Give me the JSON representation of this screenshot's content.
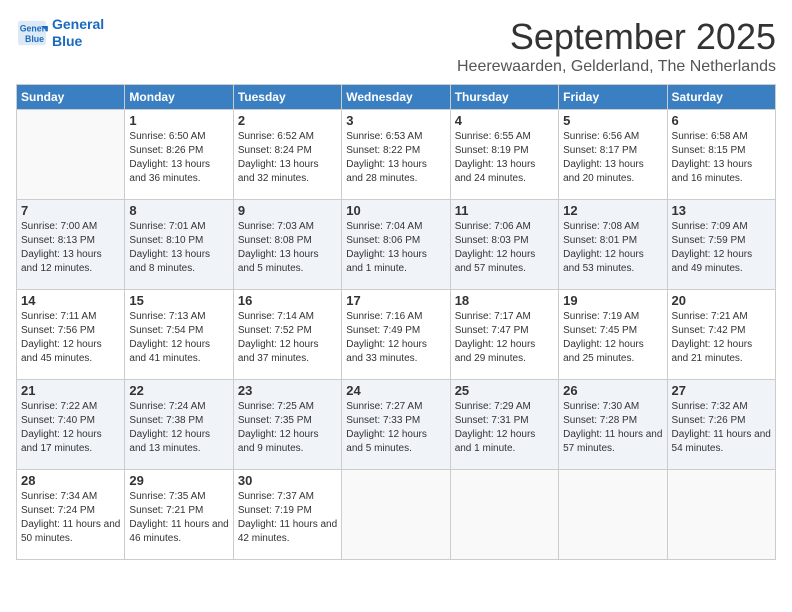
{
  "header": {
    "logo_line1": "General",
    "logo_line2": "Blue",
    "month": "September 2025",
    "location": "Heerewaarden, Gelderland, The Netherlands"
  },
  "days_of_week": [
    "Sunday",
    "Monday",
    "Tuesday",
    "Wednesday",
    "Thursday",
    "Friday",
    "Saturday"
  ],
  "weeks": [
    [
      {
        "day": null
      },
      {
        "day": "1",
        "sunrise": "6:50 AM",
        "sunset": "8:26 PM",
        "daylight": "13 hours and 36 minutes."
      },
      {
        "day": "2",
        "sunrise": "6:52 AM",
        "sunset": "8:24 PM",
        "daylight": "13 hours and 32 minutes."
      },
      {
        "day": "3",
        "sunrise": "6:53 AM",
        "sunset": "8:22 PM",
        "daylight": "13 hours and 28 minutes."
      },
      {
        "day": "4",
        "sunrise": "6:55 AM",
        "sunset": "8:19 PM",
        "daylight": "13 hours and 24 minutes."
      },
      {
        "day": "5",
        "sunrise": "6:56 AM",
        "sunset": "8:17 PM",
        "daylight": "13 hours and 20 minutes."
      },
      {
        "day": "6",
        "sunrise": "6:58 AM",
        "sunset": "8:15 PM",
        "daylight": "13 hours and 16 minutes."
      }
    ],
    [
      {
        "day": "7",
        "sunrise": "7:00 AM",
        "sunset": "8:13 PM",
        "daylight": "13 hours and 12 minutes."
      },
      {
        "day": "8",
        "sunrise": "7:01 AM",
        "sunset": "8:10 PM",
        "daylight": "13 hours and 8 minutes."
      },
      {
        "day": "9",
        "sunrise": "7:03 AM",
        "sunset": "8:08 PM",
        "daylight": "13 hours and 5 minutes."
      },
      {
        "day": "10",
        "sunrise": "7:04 AM",
        "sunset": "8:06 PM",
        "daylight": "13 hours and 1 minute."
      },
      {
        "day": "11",
        "sunrise": "7:06 AM",
        "sunset": "8:03 PM",
        "daylight": "12 hours and 57 minutes."
      },
      {
        "day": "12",
        "sunrise": "7:08 AM",
        "sunset": "8:01 PM",
        "daylight": "12 hours and 53 minutes."
      },
      {
        "day": "13",
        "sunrise": "7:09 AM",
        "sunset": "7:59 PM",
        "daylight": "12 hours and 49 minutes."
      }
    ],
    [
      {
        "day": "14",
        "sunrise": "7:11 AM",
        "sunset": "7:56 PM",
        "daylight": "12 hours and 45 minutes."
      },
      {
        "day": "15",
        "sunrise": "7:13 AM",
        "sunset": "7:54 PM",
        "daylight": "12 hours and 41 minutes."
      },
      {
        "day": "16",
        "sunrise": "7:14 AM",
        "sunset": "7:52 PM",
        "daylight": "12 hours and 37 minutes."
      },
      {
        "day": "17",
        "sunrise": "7:16 AM",
        "sunset": "7:49 PM",
        "daylight": "12 hours and 33 minutes."
      },
      {
        "day": "18",
        "sunrise": "7:17 AM",
        "sunset": "7:47 PM",
        "daylight": "12 hours and 29 minutes."
      },
      {
        "day": "19",
        "sunrise": "7:19 AM",
        "sunset": "7:45 PM",
        "daylight": "12 hours and 25 minutes."
      },
      {
        "day": "20",
        "sunrise": "7:21 AM",
        "sunset": "7:42 PM",
        "daylight": "12 hours and 21 minutes."
      }
    ],
    [
      {
        "day": "21",
        "sunrise": "7:22 AM",
        "sunset": "7:40 PM",
        "daylight": "12 hours and 17 minutes."
      },
      {
        "day": "22",
        "sunrise": "7:24 AM",
        "sunset": "7:38 PM",
        "daylight": "12 hours and 13 minutes."
      },
      {
        "day": "23",
        "sunrise": "7:25 AM",
        "sunset": "7:35 PM",
        "daylight": "12 hours and 9 minutes."
      },
      {
        "day": "24",
        "sunrise": "7:27 AM",
        "sunset": "7:33 PM",
        "daylight": "12 hours and 5 minutes."
      },
      {
        "day": "25",
        "sunrise": "7:29 AM",
        "sunset": "7:31 PM",
        "daylight": "12 hours and 1 minute."
      },
      {
        "day": "26",
        "sunrise": "7:30 AM",
        "sunset": "7:28 PM",
        "daylight": "11 hours and 57 minutes."
      },
      {
        "day": "27",
        "sunrise": "7:32 AM",
        "sunset": "7:26 PM",
        "daylight": "11 hours and 54 minutes."
      }
    ],
    [
      {
        "day": "28",
        "sunrise": "7:34 AM",
        "sunset": "7:24 PM",
        "daylight": "11 hours and 50 minutes."
      },
      {
        "day": "29",
        "sunrise": "7:35 AM",
        "sunset": "7:21 PM",
        "daylight": "11 hours and 46 minutes."
      },
      {
        "day": "30",
        "sunrise": "7:37 AM",
        "sunset": "7:19 PM",
        "daylight": "11 hours and 42 minutes."
      },
      {
        "day": null
      },
      {
        "day": null
      },
      {
        "day": null
      },
      {
        "day": null
      }
    ]
  ]
}
